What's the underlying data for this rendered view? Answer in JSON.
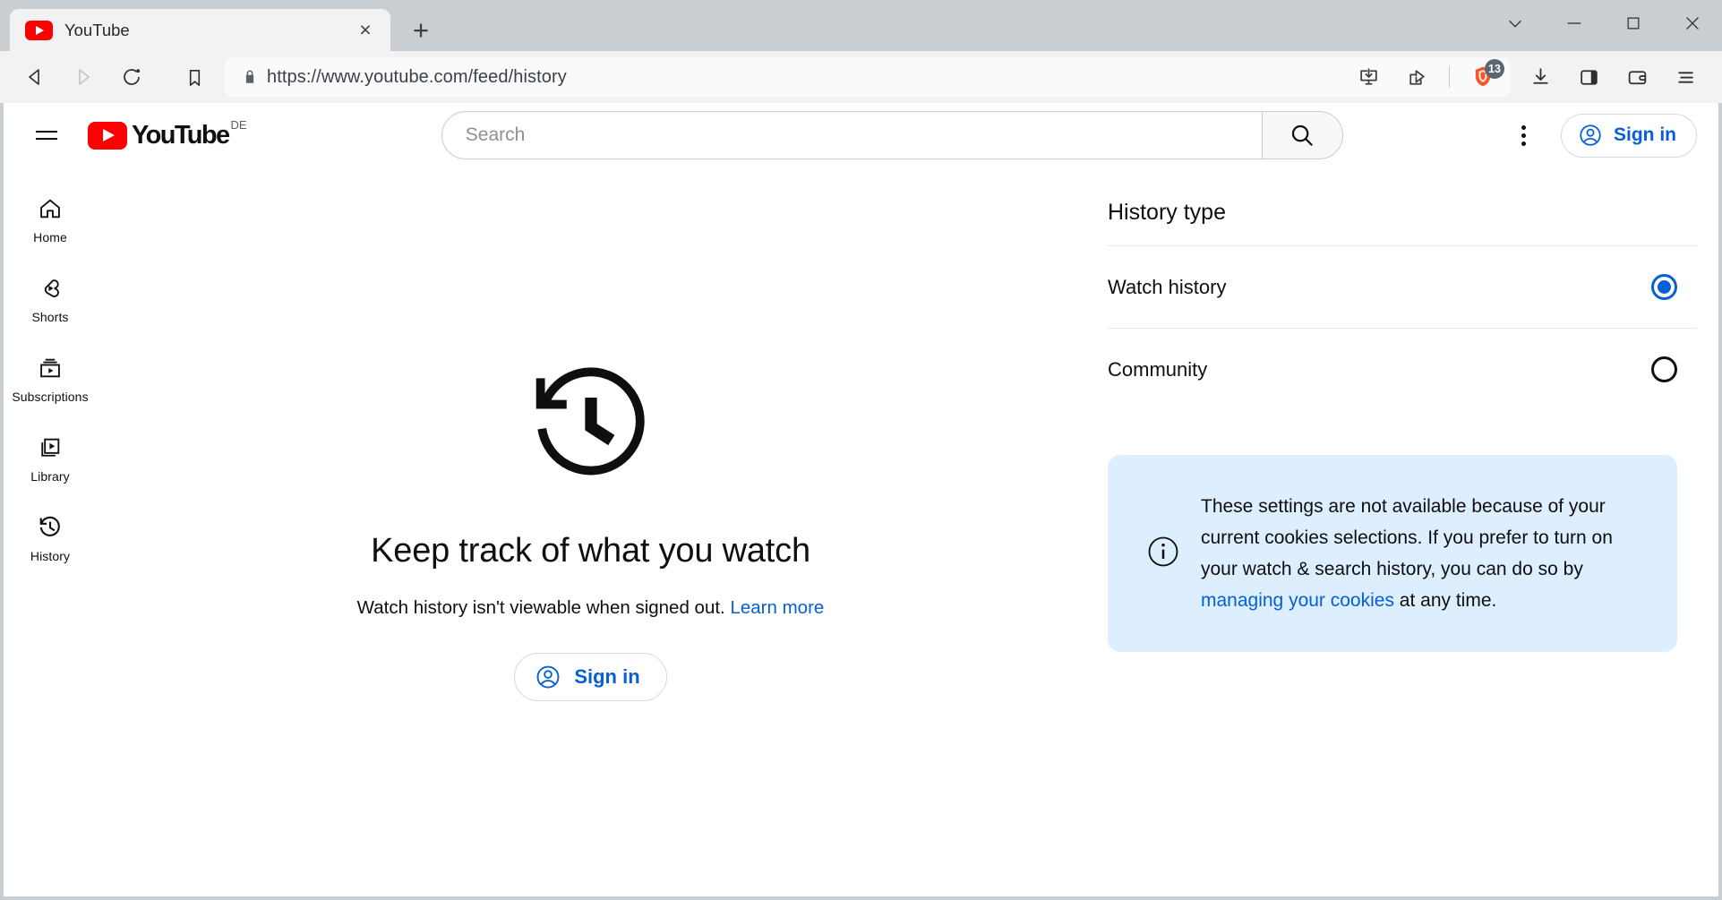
{
  "window": {
    "controls": {
      "tab_search": "tab-search-chevron",
      "minimize": "minimize",
      "maximize": "maximize",
      "close": "close"
    }
  },
  "browser": {
    "tab": {
      "title": "YouTube",
      "favicon": "youtube-favicon",
      "close_label": "×"
    },
    "new_tab_label": "+",
    "nav": {
      "back": "back-arrow",
      "forward": "forward-arrow",
      "reload": "reload-arrow",
      "bookmark": "bookmark-flag"
    },
    "address": {
      "url": "https://www.youtube.com/feed/history",
      "lock": "padlock-icon"
    },
    "address_actions": {
      "install": "install-app-icon",
      "share": "share-icon",
      "shields": "brave-shields-icon",
      "shields_badge": "13"
    },
    "toolbar_actions": {
      "downloads": "downloads-icon",
      "sidebar": "sidebar-panel-icon",
      "wallet": "wallet-icon",
      "menu": "hamburger-menu-icon"
    }
  },
  "youtube": {
    "header": {
      "menu": "guide-hamburger-icon",
      "logo_text": "YouTube",
      "country_code": "DE",
      "search_placeholder": "Search",
      "search_value": "",
      "search_button": "search-icon",
      "kebab": "more-vertical-icon",
      "sign_in_label": "Sign in"
    },
    "sidebar": {
      "items": [
        {
          "label": "Home",
          "icon": "home-icon"
        },
        {
          "label": "Shorts",
          "icon": "shorts-icon"
        },
        {
          "label": "Subscriptions",
          "icon": "subscriptions-icon"
        },
        {
          "label": "Library",
          "icon": "library-icon"
        },
        {
          "label": "History",
          "icon": "history-clock-icon"
        }
      ]
    },
    "empty_state": {
      "icon": "history-clock-large-icon",
      "title": "Keep track of what you watch",
      "subtitle": "Watch history isn't viewable when signed out.",
      "learn_more": "Learn more",
      "sign_in_label": "Sign in"
    },
    "settings": {
      "title": "History type",
      "options": [
        {
          "label": "Watch history",
          "selected": true
        },
        {
          "label": "Community",
          "selected": false
        }
      ],
      "notice": {
        "icon": "info-icon",
        "text_part1": "These settings are not available because of your current cookies selections. If you prefer to turn on your watch & search history, you can do so by ",
        "link": "managing your cookies",
        "text_part2": " at any time."
      }
    }
  },
  "colors": {
    "brand_red": "#ff0000",
    "link_blue": "#065fd4",
    "notice_bg": "#ddeeff",
    "chrome_bg": "#c9ced3",
    "toolbar_bg": "#f2f2f3"
  }
}
